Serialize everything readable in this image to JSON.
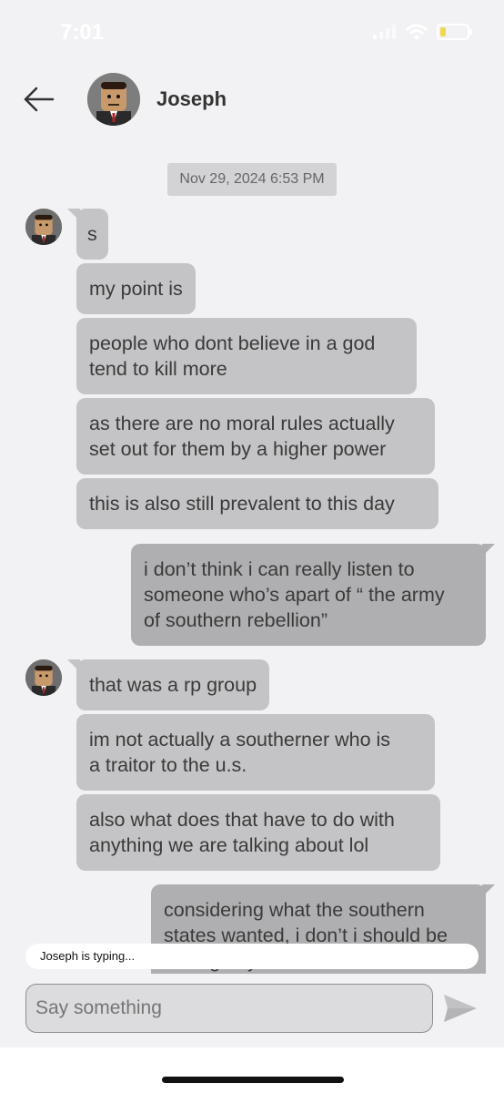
{
  "status": {
    "time": "7:01"
  },
  "header": {
    "name": "Joseph"
  },
  "timestamp": "Nov 29, 2024 6:53 PM",
  "messages": [
    {
      "dir": "in",
      "lines": [
        "s"
      ]
    },
    {
      "dir": "in",
      "lines": [
        "my point is"
      ]
    },
    {
      "dir": "in",
      "lines": [
        "people who dont believe in a god",
        "tend to kill more"
      ]
    },
    {
      "dir": "in",
      "lines": [
        "as there are no moral rules actually",
        "set out for them by a higher power"
      ]
    },
    {
      "dir": "in",
      "lines": [
        "this is also still prevalent to this day"
      ]
    },
    {
      "dir": "out",
      "lines": [
        "i don’t think i can really listen to",
        "someone who’s apart of “ the army",
        "of southern rebellion”"
      ]
    },
    {
      "dir": "in",
      "lines": [
        "that was a rp group"
      ]
    },
    {
      "dir": "in",
      "lines": [
        "im not actually a southerner who is",
        "a traitor to the u.s."
      ]
    },
    {
      "dir": "in",
      "lines": [
        "also what does that have to do with",
        "anything we are talking about lol"
      ]
    },
    {
      "dir": "out",
      "lines": [
        "considering what the southern",
        "states wanted, i don’t i should be",
        "talking to you at all"
      ]
    }
  ],
  "typing_indicator": "Joseph is typing...",
  "composer": {
    "placeholder": "Say something"
  },
  "icons": {
    "back": "arrow-left-icon",
    "send": "send-icon",
    "wifi": "wifi-icon",
    "signal": "cellular-signal-icon",
    "battery": "battery-icon"
  }
}
